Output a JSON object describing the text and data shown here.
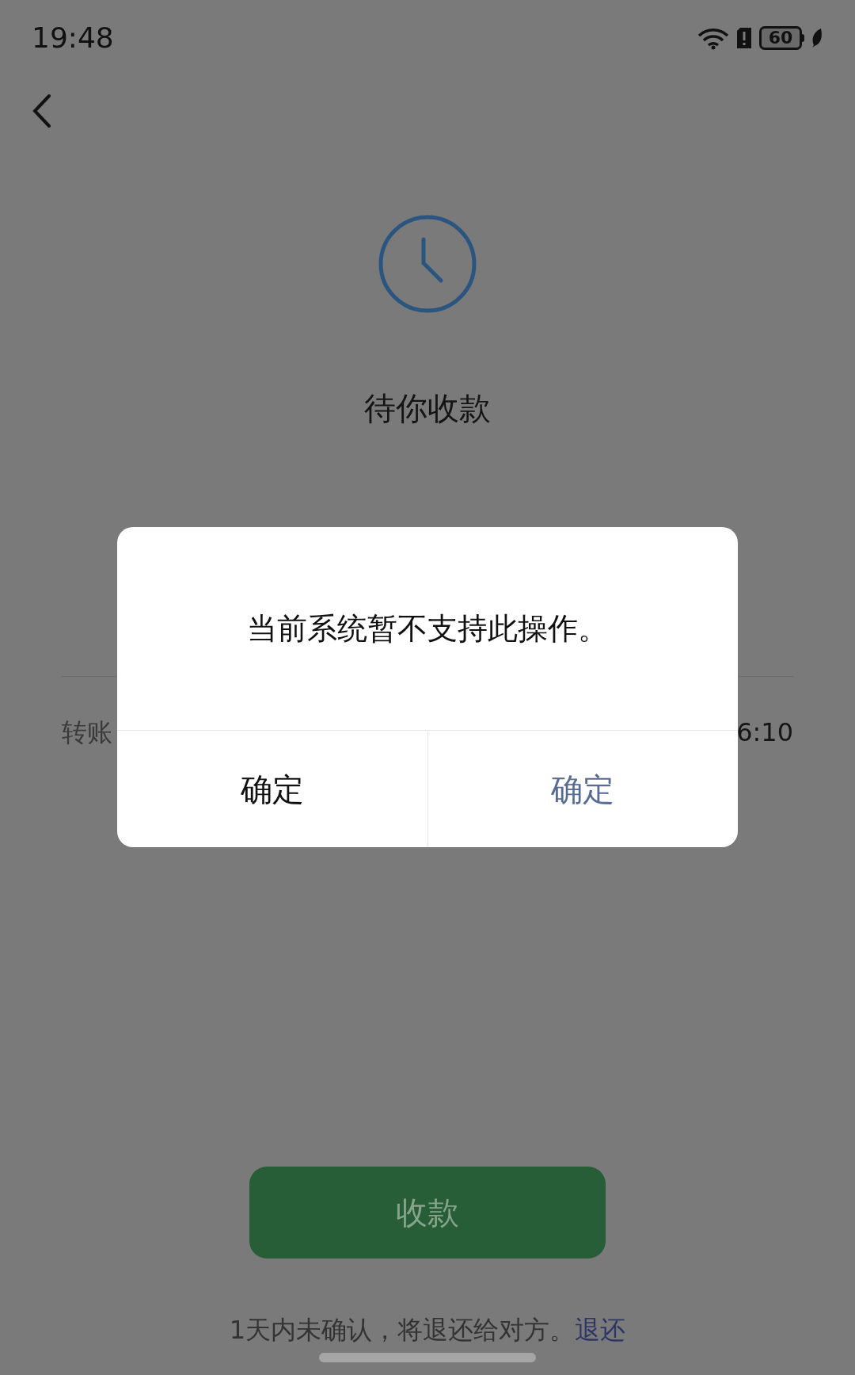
{
  "status_bar": {
    "time": "19:48",
    "battery": "60"
  },
  "transfer": {
    "status": "待你收款",
    "detail_label": "转账",
    "detail_value": "6:10"
  },
  "receive_button": {
    "label": "收款"
  },
  "notice": {
    "text": "1天内未确认，将退还给对方。",
    "link": "退还"
  },
  "dialog": {
    "message": "当前系统暂不支持此操作。",
    "buttons": [
      {
        "label": "确定",
        "kind": "secondary"
      },
      {
        "label": "确定",
        "kind": "primary"
      }
    ]
  }
}
